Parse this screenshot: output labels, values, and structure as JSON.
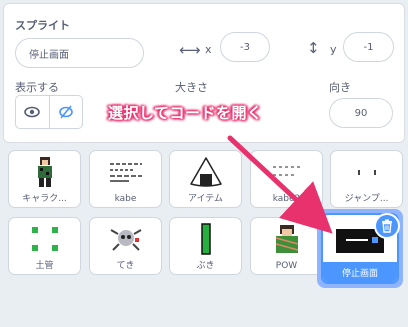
{
  "sprite_info": {
    "sprite_label": "スプライト",
    "sprite_name": "停止画面",
    "x_label": "x",
    "x_value": "-3",
    "y_label": "y",
    "y_value": "-1",
    "show_label": "表示する",
    "size_label": "大きさ",
    "direction_label": "向き",
    "direction_value": "90"
  },
  "sprites": [
    {
      "name": "キャラク...",
      "icon": "character-sprite-icon"
    },
    {
      "name": "kabe",
      "icon": "wall-lines-icon"
    },
    {
      "name": "アイテム",
      "icon": "onigiri-icon"
    },
    {
      "name": "kabe2",
      "icon": "wall2-icon"
    },
    {
      "name": "ジャンプ...",
      "icon": "jump-effect-icon"
    },
    {
      "name": "土管",
      "icon": "pipe-corners-icon"
    },
    {
      "name": "てき",
      "icon": "enemy-icon"
    },
    {
      "name": "ぶき",
      "icon": "weapon-bar-icon"
    },
    {
      "name": "POW",
      "icon": "pow-character-icon"
    },
    {
      "name": "停止画面",
      "icon": "stop-screen-icon"
    }
  ],
  "annotation": {
    "callout_text": "選択してコードを開く",
    "arrow_color": "#e8326e"
  },
  "colors": {
    "accent": "#4c97ff",
    "selection_halo": "#8fb4ff",
    "text": "#575e75"
  }
}
